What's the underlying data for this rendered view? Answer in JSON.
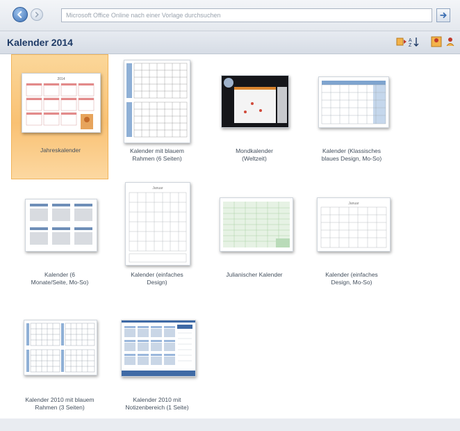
{
  "search": {
    "placeholder": "Microsoft Office Online nach einer Vorlage durchsuchen"
  },
  "header": {
    "title": "Kalender 2014"
  },
  "toolbar_icons": [
    "view-large-icon",
    "sort-icon",
    "view-medium-icon",
    "view-small-icon"
  ],
  "templates": [
    {
      "id": "t1",
      "lines": [
        "Jahreskalender"
      ],
      "selected": true
    },
    {
      "id": "t2",
      "lines": [
        "Kalender mit blauem",
        "Rahmen (6 Seiten)"
      ],
      "selected": false
    },
    {
      "id": "t3",
      "lines": [
        "Mondkalender",
        "(Weltzeit)"
      ],
      "selected": false
    },
    {
      "id": "t4",
      "lines": [
        "Kalender (Klassisches",
        "blaues Design, Mo-So)"
      ],
      "selected": false
    },
    {
      "id": "t5",
      "lines": [
        "Kalender (6",
        "Monate/Seite, Mo-So)"
      ],
      "selected": false
    },
    {
      "id": "t6",
      "lines": [
        "Kalender (einfaches",
        "Design)"
      ],
      "selected": false
    },
    {
      "id": "t7",
      "lines": [
        "Julianischer Kalender"
      ],
      "selected": false
    },
    {
      "id": "t8",
      "lines": [
        "Kalender (einfaches",
        "Design, Mo-So)"
      ],
      "selected": false
    },
    {
      "id": "t9",
      "lines": [
        "Kalender 2010 mit blauem",
        "Rahmen (3 Seiten)"
      ],
      "selected": false
    },
    {
      "id": "t10",
      "lines": [
        "Kalender 2010 mit",
        "Notizenbereich (1 Seite)"
      ],
      "selected": false
    }
  ],
  "colors": {
    "accent": "#1e3a66",
    "selection": "#f9c173",
    "calendar_blue": "#7ea4cf",
    "calendar_green": "#b9dbb8"
  }
}
